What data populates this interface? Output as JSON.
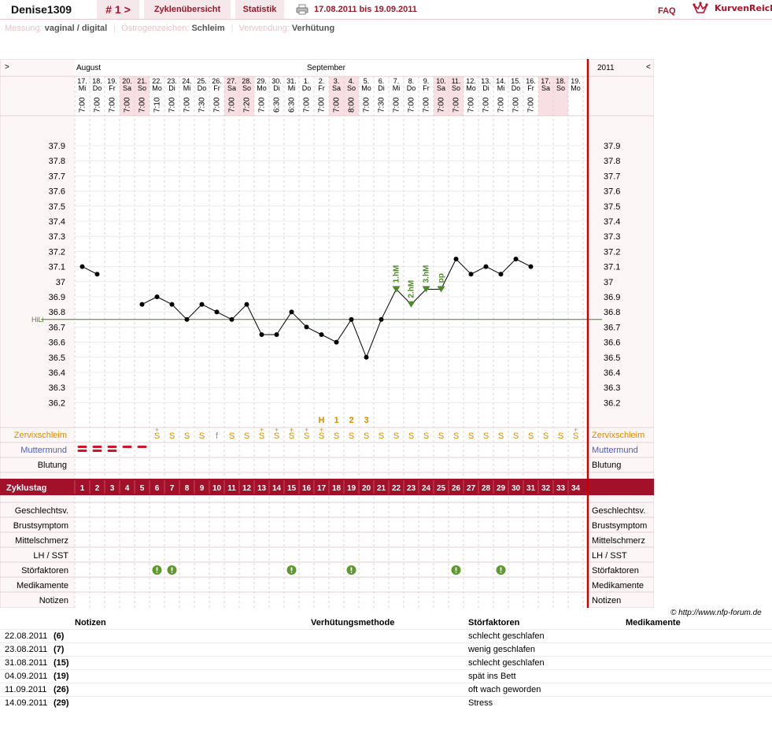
{
  "header": {
    "username": "Denise1309",
    "cycle_label": "# 1 >",
    "tab_overview": "Zyklenübersicht",
    "tab_stats": "Statistik",
    "date_range": "17.08.2011 bis 19.09.2011",
    "faq": "FAQ",
    "logo_text": "KurvenReich"
  },
  "subheader": {
    "measure_label": "Messung:",
    "measure_value": "vaginal / digital",
    "estrogen_label": "Östrogenzeichen:",
    "estrogen_value": "Schleim",
    "usage_label": "Verwendung:",
    "usage_value": "Verhütung"
  },
  "chart": {
    "nav_left": ">",
    "nav_right": "<",
    "month_aug": "August",
    "month_sep": "September",
    "year": "2011",
    "hili_label": "HiLi",
    "hili_value": 36.75,
    "y_ticks": [
      "37.9",
      "37.8",
      "37.7",
      "37.6",
      "37.5",
      "37.4",
      "37.3",
      "37.2",
      "37.1",
      "37",
      "36.9",
      "36.8",
      "36.7",
      "36.6",
      "36.5",
      "36.4",
      "36.3",
      "36.2"
    ],
    "days": [
      "17.",
      "18.",
      "19.",
      "20.",
      "21.",
      "22.",
      "23.",
      "24.",
      "25.",
      "26.",
      "27.",
      "28.",
      "29.",
      "30.",
      "31.",
      "1.",
      "2.",
      "3.",
      "4.",
      "5.",
      "6.",
      "7.",
      "8.",
      "9.",
      "10.",
      "11.",
      "12.",
      "13.",
      "14.",
      "15.",
      "16.",
      "17.",
      "18.",
      "19."
    ],
    "weekdays": [
      "Mi",
      "Do",
      "Fr",
      "Sa",
      "So",
      "Mo",
      "Di",
      "Mi",
      "Do",
      "Fr",
      "Sa",
      "So",
      "Mo",
      "Di",
      "Mi",
      "Do",
      "Fr",
      "Sa",
      "So",
      "Mo",
      "Di",
      "Mi",
      "Do",
      "Fr",
      "Sa",
      "So",
      "Mo",
      "Di",
      "Mi",
      "Do",
      "Fr",
      "Sa",
      "So",
      "Mo"
    ],
    "times": [
      "7:00",
      "7:00",
      "7:00",
      "7:00",
      "7:00",
      "7:10",
      "7:00",
      "7:00",
      "7:30",
      "7:00",
      "7:00",
      "7:20",
      "7:00",
      "6:30",
      "6:30",
      "7:00",
      "7:00",
      "7:00",
      "8:00",
      "7:00",
      "7:30",
      "7:00",
      "7:00",
      "7:00",
      "7:00",
      "7:00",
      "7:00",
      "7:00",
      "7:00",
      "7:00",
      "7:00",
      "",
      "",
      ""
    ],
    "pink_days": [
      3,
      4,
      10,
      11,
      17,
      18,
      24,
      25,
      31,
      32
    ],
    "temps": [
      37.1,
      37.05,
      null,
      null,
      36.85,
      36.9,
      36.85,
      36.75,
      36.85,
      36.8,
      36.75,
      36.85,
      36.65,
      36.65,
      36.8,
      36.7,
      36.65,
      36.6,
      36.75,
      36.5,
      36.75,
      36.95,
      36.85,
      36.95,
      36.95,
      37.15,
      37.05,
      37.1,
      37.05,
      37.15,
      37.1,
      null,
      null,
      null
    ],
    "markers": [
      {
        "day": 21,
        "label": "1.hM"
      },
      {
        "day": 22,
        "label": "2.hM"
      },
      {
        "day": 23,
        "label": "3.hM"
      },
      {
        "day": 24,
        "label": "pp"
      }
    ],
    "h_labels": [
      {
        "day": 16,
        "label": "H"
      },
      {
        "day": 17,
        "label": "1"
      },
      {
        "day": 18,
        "label": "2"
      },
      {
        "day": 19,
        "label": "3"
      }
    ],
    "cervix_label": "Zervixschleim",
    "cervix": [
      "",
      "",
      "",
      "",
      "",
      "S+",
      "S",
      "S",
      "S",
      "f",
      "S",
      "S",
      "S+",
      "S+",
      "S+",
      "S+",
      "S+",
      "S",
      "S",
      "S",
      "S",
      "S",
      "S",
      "S",
      "S",
      "S",
      "S",
      "S",
      "S",
      "S",
      "S",
      "S",
      "S",
      "S+"
    ],
    "os_label": "Muttermund",
    "bleeding_label": "Blutung",
    "bleeding": [
      "double",
      "double",
      "double",
      "single",
      "single",
      "",
      "",
      "",
      "",
      "",
      "",
      "",
      "",
      "",
      "",
      "",
      "",
      "",
      "",
      "",
      "",
      "",
      "",
      "",
      "",
      "",
      "",
      "",
      "",
      "",
      "",
      "",
      "",
      ""
    ],
    "cycle_label": "Zyklustag",
    "cycle_days": [
      "1",
      "2",
      "3",
      "4",
      "5",
      "6",
      "7",
      "8",
      "9",
      "10",
      "11",
      "12",
      "13",
      "14",
      "15",
      "16",
      "17",
      "18",
      "19",
      "20",
      "21",
      "22",
      "23",
      "24",
      "25",
      "26",
      "27",
      "28",
      "29",
      "30",
      "31",
      "32",
      "33",
      "34"
    ],
    "rows_bottom": [
      "Geschlechtsv.",
      "Brustsymptom",
      "Mittelschmerz",
      "LH / SST",
      "Störfaktoren",
      "Medikamente",
      "Notizen"
    ],
    "disturbance_days": [
      5,
      6,
      14,
      18,
      25,
      28
    ]
  },
  "credit": "© http://www.nfp-forum.de",
  "notes": {
    "headers": {
      "notes": "Notizen",
      "method": "Verhütungsmethode",
      "factors": "Störfaktoren",
      "meds": "Medikamente"
    },
    "rows": [
      {
        "date": "22.08.2011",
        "day": "(6)",
        "factor": "schlecht geschlafen"
      },
      {
        "date": "23.08.2011",
        "day": "(7)",
        "factor": "wenig geschlafen"
      },
      {
        "date": "31.08.2011",
        "day": "(15)",
        "factor": "schlecht geschlafen"
      },
      {
        "date": "04.09.2011",
        "day": "(19)",
        "factor": "spät ins Bett"
      },
      {
        "date": "11.09.2011",
        "day": "(26)",
        "factor": "oft wach geworden"
      },
      {
        "date": "14.09.2011",
        "day": "(29)",
        "factor": "Stress"
      }
    ]
  }
}
